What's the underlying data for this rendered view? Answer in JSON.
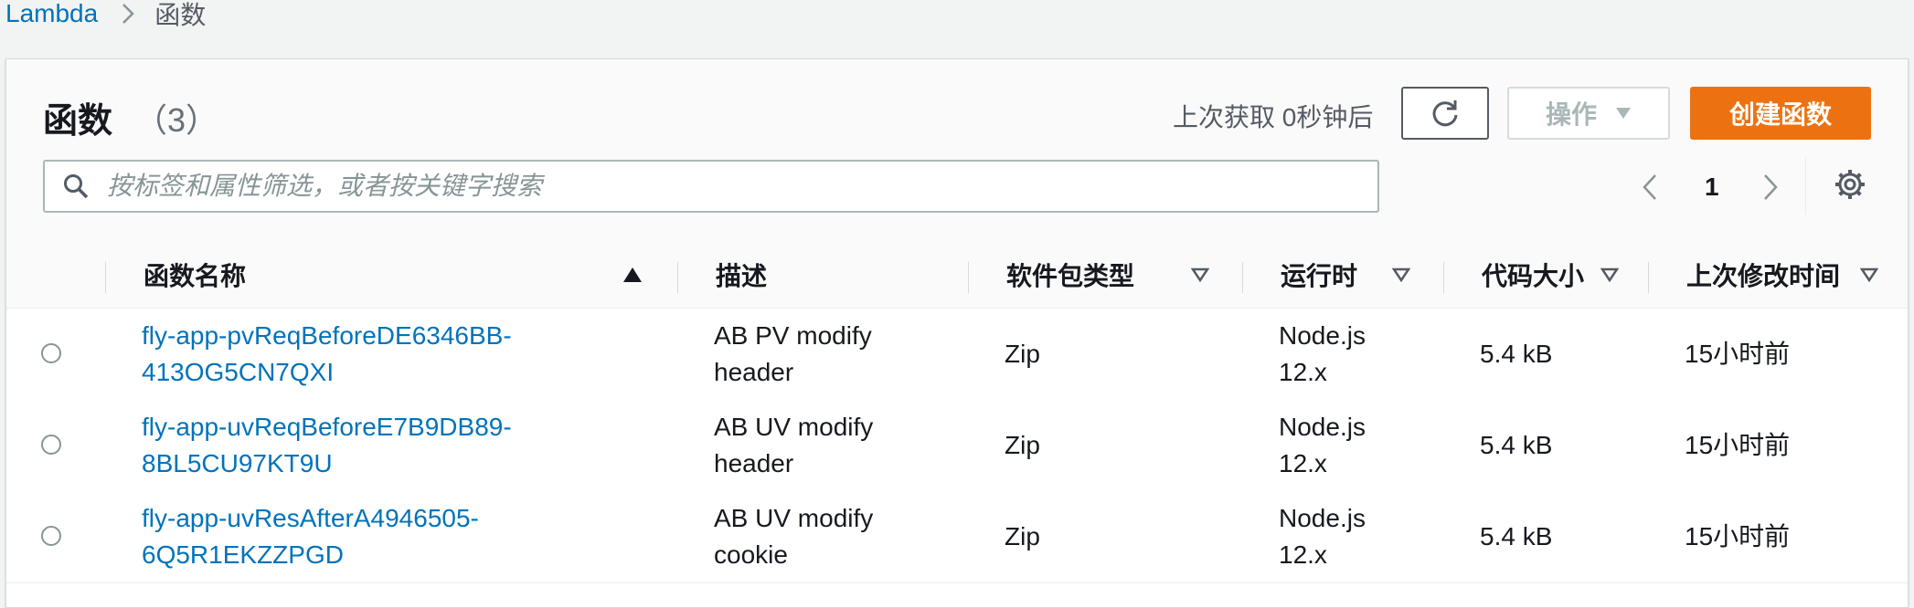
{
  "breadcrumb": {
    "root": "Lambda",
    "current": "函数"
  },
  "header": {
    "title": "函数",
    "count": "（3）",
    "last_fetch": "上次获取 0秒钟后",
    "actions_label": "操作",
    "create_label": "创建函数"
  },
  "search": {
    "placeholder": "按标签和属性筛选，或者按关键字搜索"
  },
  "pagination": {
    "current_page": "1"
  },
  "table": {
    "columns": [
      "函数名称",
      "描述",
      "软件包类型",
      "运行时",
      "代码大小",
      "上次修改时间"
    ],
    "rows": [
      {
        "name_line1": "fly-app-pvReqBeforeDE6346BB-",
        "name_line2": "413OG5CN7QXI",
        "desc_line1": "AB PV modify",
        "desc_line2": "header",
        "package": "Zip",
        "runtime_line1": "Node.js",
        "runtime_line2": "12.x",
        "size": "5.4 kB",
        "modified": "15小时前"
      },
      {
        "name_line1": "fly-app-uvReqBeforeE7B9DB89-",
        "name_line2": "8BL5CU97KT9U",
        "desc_line1": "AB UV modify",
        "desc_line2": "header",
        "package": "Zip",
        "runtime_line1": "Node.js",
        "runtime_line2": "12.x",
        "size": "5.4 kB",
        "modified": "15小时前"
      },
      {
        "name_line1": "fly-app-uvResAfterA4946505-",
        "name_line2": "6Q5R1EKZZPGD",
        "desc_line1": "AB UV modify",
        "desc_line2": "cookie",
        "package": "Zip",
        "runtime_line1": "Node.js",
        "runtime_line2": "12.x",
        "size": "5.4 kB",
        "modified": "15小时前"
      }
    ]
  },
  "colors": {
    "link": "#0073bb",
    "primary_button": "#ec7211",
    "disabled_text": "#aab7b8",
    "background": "#f2f3f3"
  },
  "icons": [
    "chevron-right-icon",
    "refresh-icon",
    "caret-down-icon",
    "search-icon",
    "chevron-left-icon",
    "settings-gear-icon",
    "sort-ascending-icon",
    "sort-descending-icon",
    "radio-button"
  ]
}
